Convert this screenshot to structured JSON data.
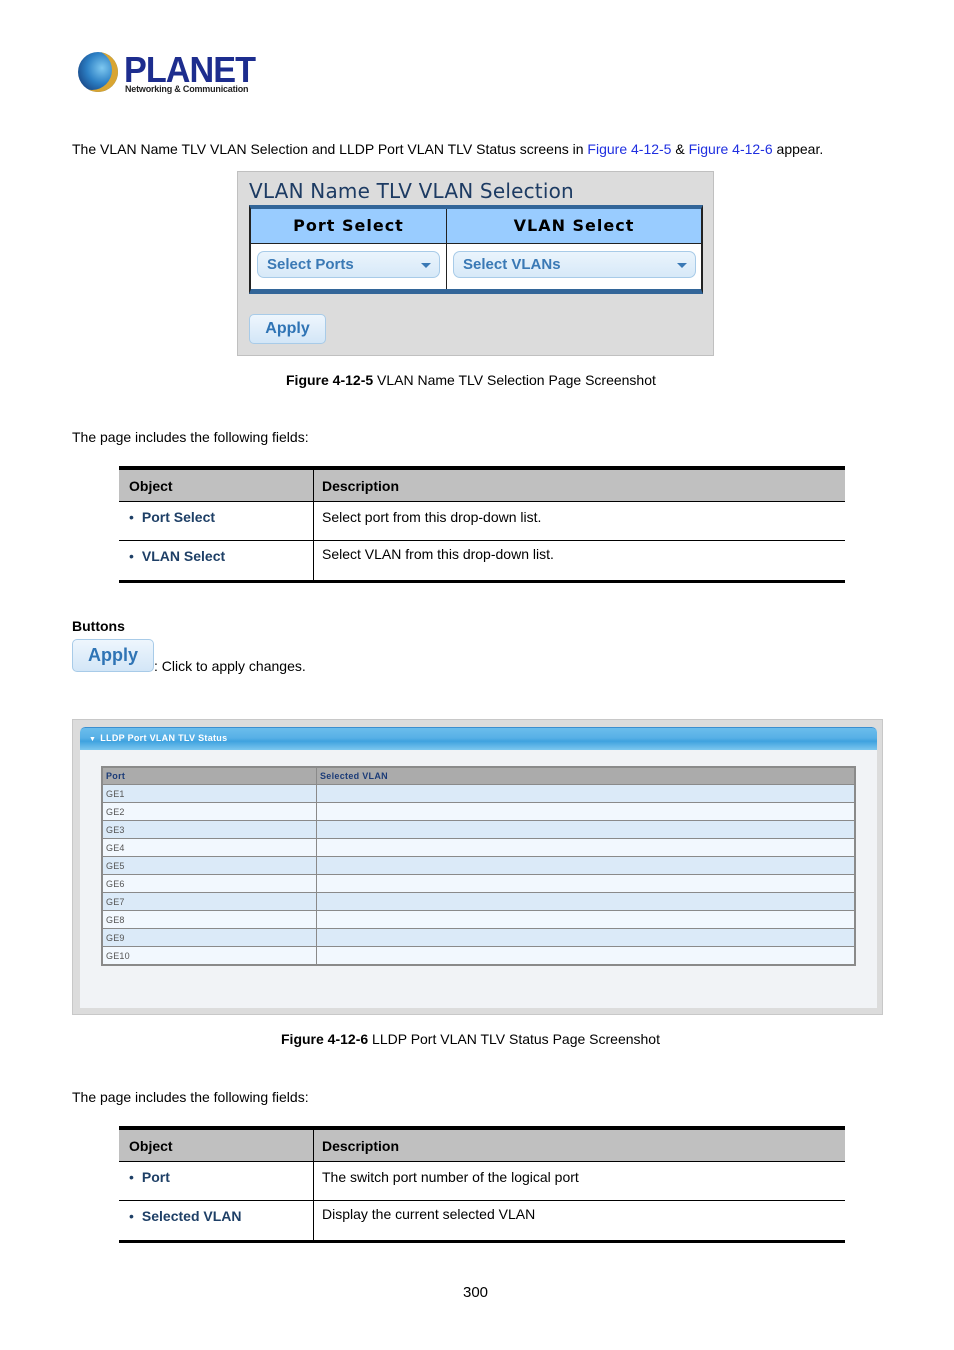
{
  "logo": {
    "brand": "PLANET",
    "tagline": "Networking & Communication",
    "icon": "planet-globe-icon"
  },
  "intro": {
    "text_before": "The VLAN Name TLV VLAN Selection and LLDP Port VLAN TLV Status screens in ",
    "link1": "Figure 4-12-5",
    "between": " & ",
    "link2": "Figure 4-12-6",
    "text_after": " appear.",
    "link_color": "#1f2fe0"
  },
  "figure5": {
    "title": "VLAN Name TLV VLAN Selection",
    "columns": [
      "Port Select",
      "VLAN Select"
    ],
    "port_select": {
      "value": "Select Ports",
      "icon": "chevron-down-icon"
    },
    "vlan_select": {
      "value": "Select VLANs",
      "icon": "chevron-down-icon"
    },
    "apply_label": "Apply",
    "caption_bold": "Figure 4-12-5",
    "caption_text": " VLAN Name TLV Selection Page Screenshot",
    "header_color": "#99ccff",
    "border_color": "#336699"
  },
  "fields_intro_1": "The page includes the following fields:",
  "fields_table_1": {
    "headers": [
      "Object",
      "Description"
    ],
    "rows": [
      {
        "object": "Port Select",
        "description": "Select port from this drop-down list."
      },
      {
        "object": "VLAN Select",
        "description": "Select VLAN from this drop-down list."
      }
    ]
  },
  "buttons_section": {
    "heading": "Buttons",
    "apply_label": "Apply",
    "apply_desc": ": Click to apply changes."
  },
  "figure6": {
    "panel_title": "LLDP Port VLAN TLV Status",
    "panel_icon": "collapse-arrow-icon",
    "columns": [
      "Port",
      "Selected VLAN"
    ],
    "rows": [
      {
        "port": "GE1",
        "vlan": ""
      },
      {
        "port": "GE2",
        "vlan": ""
      },
      {
        "port": "GE3",
        "vlan": ""
      },
      {
        "port": "GE4",
        "vlan": ""
      },
      {
        "port": "GE5",
        "vlan": ""
      },
      {
        "port": "GE6",
        "vlan": ""
      },
      {
        "port": "GE7",
        "vlan": ""
      },
      {
        "port": "GE8",
        "vlan": ""
      },
      {
        "port": "GE9",
        "vlan": ""
      },
      {
        "port": "GE10",
        "vlan": ""
      }
    ],
    "caption_bold": "Figure 4-12-6",
    "caption_text": " LLDP Port VLAN TLV Status Page Screenshot"
  },
  "fields_intro_2": "The page includes the following fields:",
  "fields_table_2": {
    "headers": [
      "Object",
      "Description"
    ],
    "rows": [
      {
        "object": "Port",
        "description": "The switch port number of the logical port"
      },
      {
        "object": "Selected VLAN",
        "description": "Display the current selected VLAN"
      }
    ]
  },
  "page_number": "300"
}
